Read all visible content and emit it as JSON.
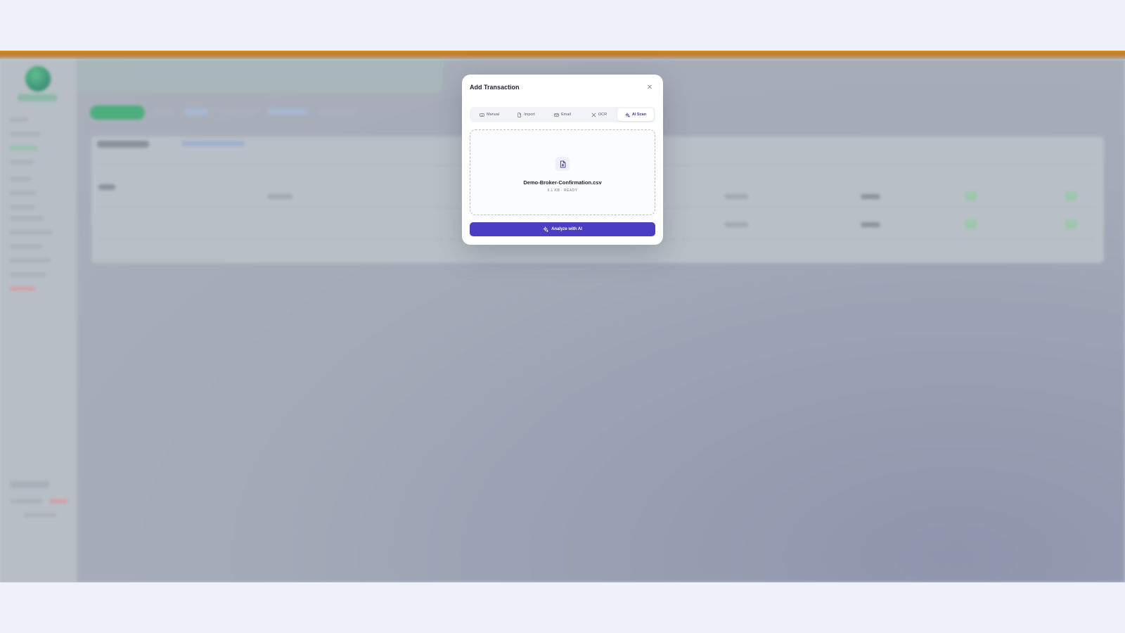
{
  "modal": {
    "title": "Add Transaction",
    "close_icon": "close-icon",
    "tabs": [
      {
        "label": "Manual",
        "icon": "keyboard-icon",
        "active": false
      },
      {
        "label": "Import",
        "icon": "file-icon",
        "active": false
      },
      {
        "label": "Email",
        "icon": "mail-icon",
        "active": false
      },
      {
        "label": "OCR",
        "icon": "scan-icon",
        "active": false
      },
      {
        "label": "AI Scan",
        "icon": "sparkles-icon",
        "active": true
      }
    ],
    "dropzone": {
      "icon": "document-icon",
      "file_name": "Demo-Broker-Confirmation.csv",
      "file_meta": "0.1 KB · READY"
    },
    "analyze_button": {
      "label": "Analyze with AI",
      "icon": "sparkles-icon"
    }
  },
  "colors": {
    "accent": "#4a3fc4",
    "page_background": "#eef2f8",
    "top_accent": "#d98a17"
  }
}
